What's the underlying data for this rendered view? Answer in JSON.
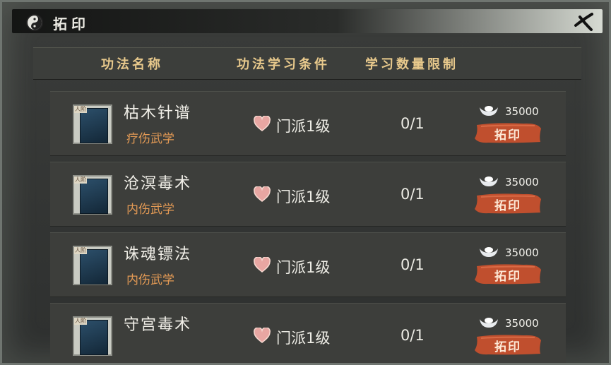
{
  "window": {
    "title": "拓印"
  },
  "icons": {
    "title": "yin-yang-icon",
    "close": "close-brush-icon",
    "condition": "heart-icon",
    "currency": "silver-ingot-icon"
  },
  "colors": {
    "header_text": "#e8c98c",
    "skill_type": "#e39a55",
    "button": "#c04f2e"
  },
  "header": {
    "col_name": "功法名称",
    "col_condition": "功法学习条件",
    "col_limit": "学习数量限制"
  },
  "rows": [
    {
      "tag": "人阶",
      "name": "枯木针谱",
      "type": "疗伤武学",
      "condition": "门派1级",
      "limit": "0/1",
      "price": "35000",
      "button": "拓印"
    },
    {
      "tag": "人阶",
      "name": "沧溟毒术",
      "type": "内伤武学",
      "condition": "门派1级",
      "limit": "0/1",
      "price": "35000",
      "button": "拓印"
    },
    {
      "tag": "人阶",
      "name": "诛魂镖法",
      "type": "内伤武学",
      "condition": "门派1级",
      "limit": "0/1",
      "price": "35000",
      "button": "拓印"
    },
    {
      "tag": "人阶",
      "name": "守宫毒术",
      "type": "",
      "condition": "门派1级",
      "limit": "0/1",
      "price": "35000",
      "button": "拓印"
    }
  ]
}
